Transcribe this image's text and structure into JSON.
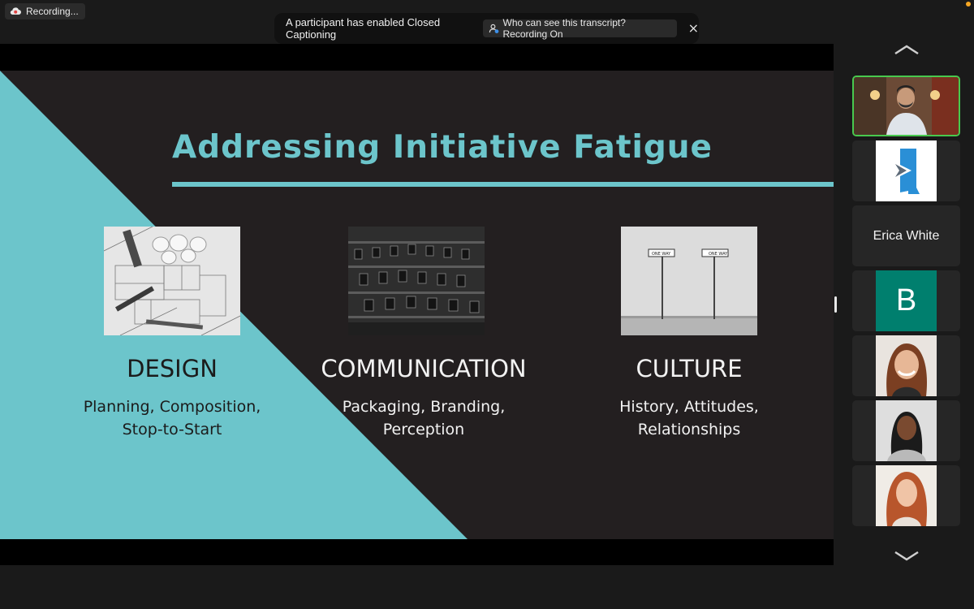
{
  "recording": {
    "label": "Recording..."
  },
  "notice": {
    "message": "A participant has enabled Closed Captioning",
    "transcript_button": "Who can see this transcript? Recording On"
  },
  "slide": {
    "title": "Addressing Initiative Fatigue",
    "columns": [
      {
        "heading": "DESIGN",
        "lines": [
          "Planning, Composition,",
          "Stop-to-Start"
        ]
      },
      {
        "heading": "COMMUNICATION",
        "lines": [
          "Packaging, Branding,",
          "Perception"
        ]
      },
      {
        "heading": "CULTURE",
        "lines": [
          "History, Attitudes,",
          "Relationships"
        ]
      }
    ],
    "sign_text": "ONE WAY",
    "colors": {
      "accent": "#6cc5cb",
      "background": "#231f20"
    }
  },
  "gallery": {
    "participants": [
      {
        "kind": "video",
        "active": true
      },
      {
        "kind": "logo"
      },
      {
        "kind": "name",
        "name": "Erica White"
      },
      {
        "kind": "initial",
        "initial": "B"
      },
      {
        "kind": "photo"
      },
      {
        "kind": "photo"
      },
      {
        "kind": "photo"
      }
    ],
    "colors": {
      "active_border": "#48c94e",
      "initial_bg": "#007f6e"
    }
  },
  "icons": [
    "cloud-record-icon",
    "person-info-icon",
    "close-icon",
    "chevron-up-icon",
    "chevron-down-icon"
  ]
}
